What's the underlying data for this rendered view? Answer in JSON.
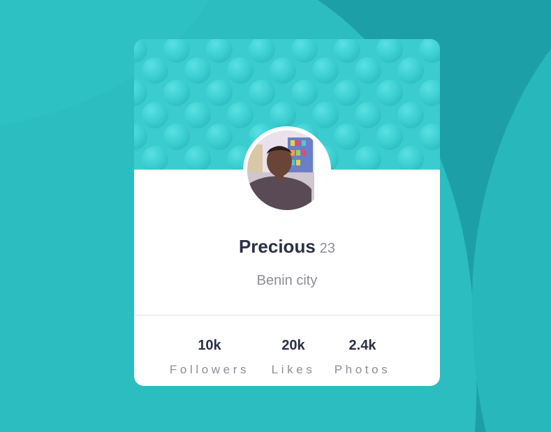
{
  "profile": {
    "name": "Precious",
    "age": "23",
    "city": "Benin city"
  },
  "stats": [
    {
      "value": "10k",
      "label": "Followers"
    },
    {
      "value": "20k",
      "label": "Likes"
    },
    {
      "value": "2.4k",
      "label": "Photos"
    }
  ],
  "icons": {
    "avatar": "profile-photo"
  },
  "colors": {
    "background": "#2bbdbf",
    "background_dark": "#1d9fa8",
    "banner": "#3dcfd3",
    "card": "#ffffff",
    "name": "#2b2f45",
    "muted": "#8c8d95",
    "divider": "#e4e5e8"
  }
}
